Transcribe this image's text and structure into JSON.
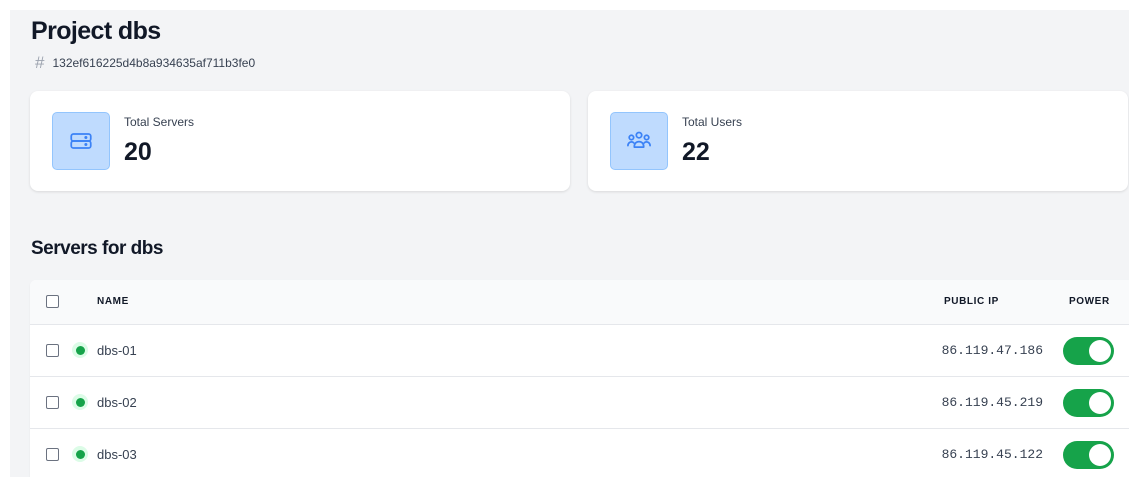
{
  "project": {
    "title": "Project dbs",
    "id_icon": "hash-icon",
    "id": "132ef616225d4b8a934635af711b3fe0"
  },
  "stats": [
    {
      "icon": "server-stack-icon",
      "label": "Total Servers",
      "value": "20"
    },
    {
      "icon": "users-group-icon",
      "label": "Total Users",
      "value": "22"
    }
  ],
  "servers_section": {
    "title": "Servers for dbs",
    "columns": {
      "name": "NAME",
      "public_ip": "PUBLIC IP",
      "power": "POWER"
    },
    "rows": [
      {
        "name": "dbs-01",
        "public_ip": "86.119.47.186",
        "status": "running",
        "power_on": true,
        "selected": false
      },
      {
        "name": "dbs-02",
        "public_ip": "86.119.45.219",
        "status": "running",
        "power_on": true,
        "selected": false
      },
      {
        "name": "dbs-03",
        "public_ip": "86.119.45.122",
        "status": "running",
        "power_on": true,
        "selected": false
      }
    ]
  },
  "colors": {
    "accent_blue": "#3b82f6",
    "icon_box_bg": "#bfdbfe",
    "status_green": "#16a34a",
    "toggle_on": "#16a34a"
  }
}
